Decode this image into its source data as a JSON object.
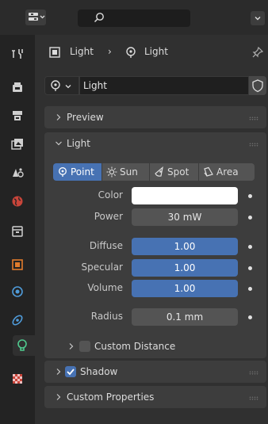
{
  "header": {
    "editor_icon": "properties-editor-icon",
    "search_icon": "search-icon",
    "options_icon": "chevron-down-icon"
  },
  "tabs": [
    {
      "name": "tool",
      "icon": "tool-icon"
    },
    {
      "name": "render",
      "icon": "render-icon"
    },
    {
      "name": "output",
      "icon": "output-icon"
    },
    {
      "name": "view-layer",
      "icon": "view-layer-icon"
    },
    {
      "name": "scene",
      "icon": "scene-icon"
    },
    {
      "name": "world",
      "icon": "world-icon"
    },
    {
      "name": "collection",
      "icon": "collection-icon"
    },
    {
      "name": "object",
      "icon": "object-icon"
    },
    {
      "name": "physics",
      "icon": "physics-icon"
    },
    {
      "name": "constraints",
      "icon": "constraints-icon"
    },
    {
      "name": "data",
      "icon": "light-data-icon",
      "active": true
    },
    {
      "name": "texture",
      "icon": "texture-icon"
    }
  ],
  "breadcrumb": {
    "object_label": "Light",
    "separator": "›",
    "data_label": "Light",
    "pin_icon": "pin-icon"
  },
  "datablock": {
    "name": "Light",
    "fake_user_icon": "shield-icon"
  },
  "panels": {
    "preview": {
      "title": "Preview",
      "expanded": false
    },
    "light": {
      "title": "Light",
      "expanded": true,
      "types": [
        {
          "label": "Point",
          "icon": "point-light-icon",
          "active": true
        },
        {
          "label": "Sun",
          "icon": "sun-light-icon",
          "active": false
        },
        {
          "label": "Spot",
          "icon": "spot-light-icon",
          "active": false
        },
        {
          "label": "Area",
          "icon": "area-light-icon",
          "active": false
        }
      ],
      "color_label": "Color",
      "color_value": "#ffffff",
      "power_label": "Power",
      "power_value": "30 mW",
      "diffuse_label": "Diffuse",
      "diffuse_value": "1.00",
      "specular_label": "Specular",
      "specular_value": "1.00",
      "volume_label": "Volume",
      "volume_value": "1.00",
      "radius_label": "Radius",
      "radius_value": "0.1 mm",
      "custom_distance_label": "Custom Distance",
      "custom_distance_checked": false
    },
    "shadow": {
      "title": "Shadow",
      "expanded": false,
      "checked": true
    },
    "custom_properties": {
      "title": "Custom Properties",
      "expanded": false
    }
  },
  "colors": {
    "accent": "#4772b3",
    "panel": "#3d3d3d",
    "background": "#303030",
    "tab_column": "#232323"
  }
}
